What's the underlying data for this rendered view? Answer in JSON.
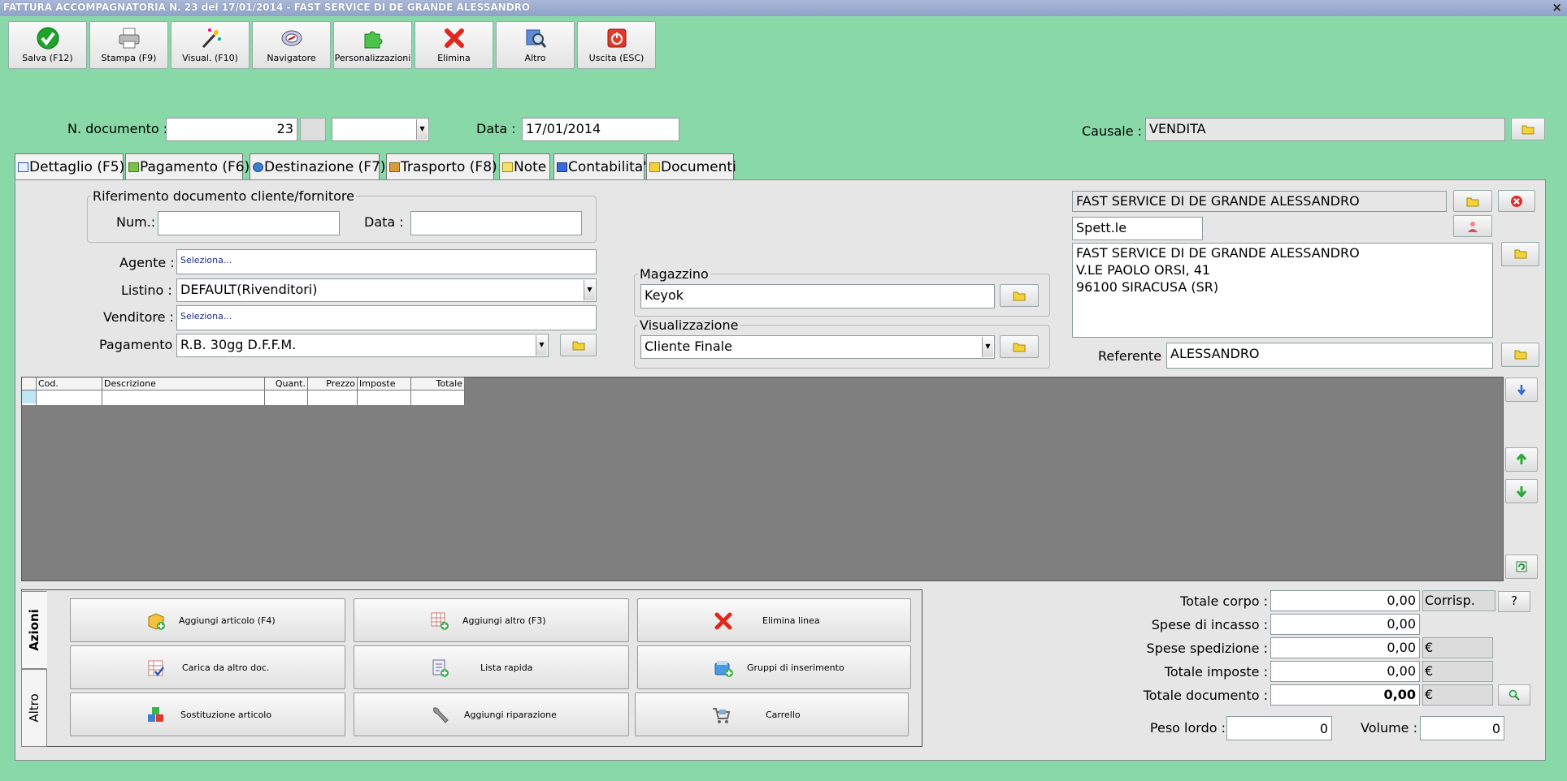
{
  "window": {
    "title": "FATTURA ACCOMPAGNATORIA N. 23 del 17/01/2014 - FAST SERVICE DI DE GRANDE ALESSANDRO",
    "close_glyph": "×"
  },
  "toolbar": [
    {
      "label": "Salva (F12)",
      "icon": "check-icon"
    },
    {
      "label": "Stampa (F9)",
      "icon": "printer-icon"
    },
    {
      "label": "Visual. (F10)",
      "icon": "magic-wand-icon"
    },
    {
      "label": "Navigatore",
      "icon": "compass-icon"
    },
    {
      "label": "Personalizzazioni",
      "icon": "puzzle-icon"
    },
    {
      "label": "Elimina",
      "icon": "delete-x-icon"
    },
    {
      "label": "Altro",
      "icon": "magnifier-icon"
    },
    {
      "label": "Uscita (ESC)",
      "icon": "power-icon"
    }
  ],
  "header": {
    "doc_number_label": "N. documento :",
    "doc_number": "23",
    "series_value": "",
    "date_label": "Data :",
    "date": "17/01/2014",
    "causale_label": "Causale :",
    "causale": "VENDITA"
  },
  "tabs": [
    {
      "label": "Dettaglio (F5)",
      "icon": "window-icon",
      "active": true
    },
    {
      "label": "Pagamento (F6)",
      "icon": "money-icon"
    },
    {
      "label": "Destinazione (F7)",
      "icon": "globe-icon"
    },
    {
      "label": "Trasporto (F8)",
      "icon": "truck-icon"
    },
    {
      "label": "Note",
      "icon": "note-icon"
    },
    {
      "label": "Contabilita'",
      "icon": "ledger-icon"
    },
    {
      "label": "Documenti",
      "icon": "folder-icon"
    }
  ],
  "riferimento": {
    "legend": "Riferimento documento cliente/fornitore",
    "num_label": "Num.:",
    "num_value": "",
    "data_label": "Data :",
    "data_value": ""
  },
  "form": {
    "agente_label": "Agente :",
    "agente_value": "Seleziona...",
    "listino_label": "Listino :",
    "listino_value": "DEFAULT(Rivenditori)",
    "venditore_label": "Venditore :",
    "venditore_value": "Seleziona...",
    "pagamento_label": "Pagamento :",
    "pagamento_value": "R.B. 30gg D.F.F.M."
  },
  "magazzino": {
    "legend": "Magazzino",
    "value": "Keyok"
  },
  "visualizzazione": {
    "legend": "Visualizzazione",
    "value": "Cliente Finale"
  },
  "cliente": {
    "name": "FAST SERVICE DI DE GRANDE ALESSANDRO",
    "salutation": "Spett.le",
    "address_lines": [
      "FAST SERVICE DI DE GRANDE ALESSANDRO",
      "V.LE PAOLO ORSI, 41",
      "96100 SIRACUSA (SR)"
    ],
    "referente_label": "Referente",
    "referente": "ALESSANDRO"
  },
  "grid": {
    "columns": [
      "",
      "Cod.",
      "Descrizione",
      "Quant.",
      "Prezzo",
      "Imposte",
      "Totale"
    ]
  },
  "actions": {
    "tab_azioni": "Azioni",
    "tab_altro": "Altro",
    "buttons": [
      {
        "label": "Aggiungi articolo (F4)",
        "icon": "add-article-icon"
      },
      {
        "label": "Aggiungi altro (F3)",
        "icon": "add-other-icon"
      },
      {
        "label": "Elimina linea",
        "icon": "delete-line-icon"
      },
      {
        "label": "Carica da altro doc.",
        "icon": "load-document-icon"
      },
      {
        "label": "Lista rapida",
        "icon": "quick-list-icon"
      },
      {
        "label": "Gruppi di inserimento",
        "icon": "insert-group-icon"
      },
      {
        "label": "Sostituzione articolo",
        "icon": "replace-article-icon"
      },
      {
        "label": "Aggiungi riparazione",
        "icon": "wrench-icon"
      },
      {
        "label": "Carrello",
        "icon": "cart-icon"
      }
    ]
  },
  "totals": {
    "totale_corpo_label": "Totale corpo :",
    "totale_corpo": "0,00",
    "corrisp": "Corrisp.",
    "help": "?",
    "spese_incasso_label": "Spese di incasso :",
    "spese_incasso": "0,00",
    "spese_spedizione_label": "Spese spedizione :",
    "spese_spedizione": "0,00",
    "totale_imposte_label": "Totale imposte :",
    "totale_imposte": "0,00",
    "totale_documento_label": "Totale documento :",
    "totale_documento": "0,00",
    "currency": "€",
    "peso_label": "Peso lordo :",
    "peso": "0",
    "volume_label": "Volume :",
    "volume": "0"
  }
}
